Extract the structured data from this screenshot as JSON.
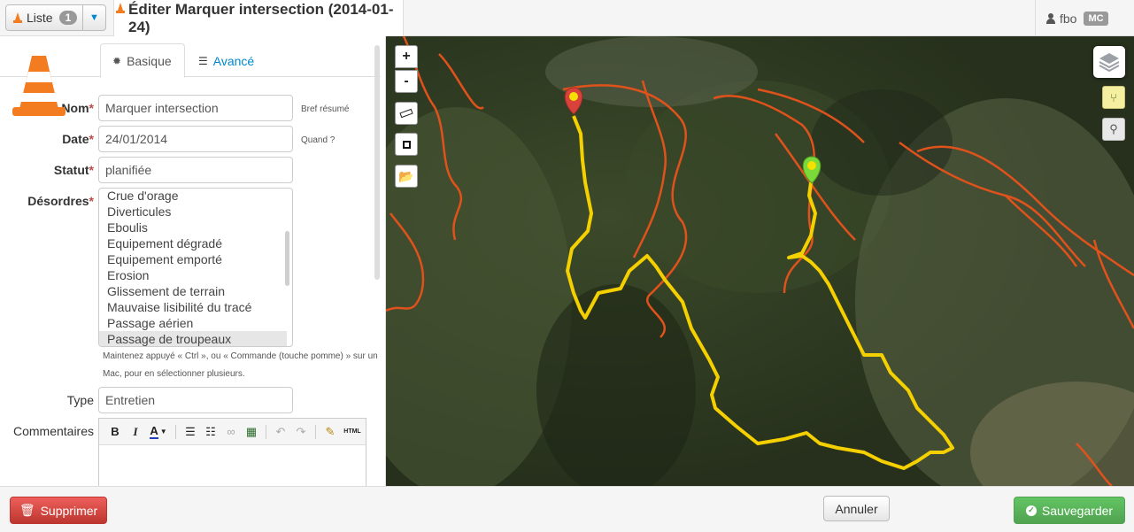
{
  "topbar": {
    "list_label": "Liste",
    "list_count": "1",
    "title": "Éditer Marquer intersection (2014-01-24)",
    "username": "fbo",
    "user_initials": "MC"
  },
  "tabs": [
    {
      "label": "Basique",
      "icon": "gear-icon",
      "active": true
    },
    {
      "label": "Avancé",
      "icon": "list-icon",
      "active": false
    }
  ],
  "form": {
    "nom": {
      "label": "Nom",
      "value": "Marquer intersection",
      "hint": "Bref résumé"
    },
    "date": {
      "label": "Date",
      "value": "24/01/2014",
      "hint": "Quand ?"
    },
    "statut": {
      "label": "Statut",
      "value": "planifiée"
    },
    "desordres": {
      "label": "Désordres",
      "options": [
        "Crue d'orage",
        "Diverticules",
        "Eboulis",
        "Equipement dégradé",
        "Equipement emporté",
        "Erosion",
        "Glissement de terrain",
        "Mauvaise lisibilité du tracé",
        "Passage aérien",
        "Passage de troupeaux"
      ],
      "selected": "Passage de troupeaux",
      "help_line1": "Maintenez appuyé « Ctrl », ou « Commande (touche pomme) » sur un",
      "help_line2": "Mac, pour en sélectionner plusieurs."
    },
    "type": {
      "label": "Type",
      "value": "Entretien"
    },
    "commentaires": {
      "label": "Commentaires",
      "toolbar_html_label": "HTML"
    }
  },
  "map_controls": {
    "zoom_in": "+",
    "zoom_out": "-"
  },
  "footer": {
    "delete_label": "Supprimer",
    "cancel_label": "Annuler",
    "save_label": "Sauvegarder"
  },
  "colors": {
    "accent": "#0088cc",
    "danger": "#bd362f",
    "success": "#51a351",
    "track": "#f5d000",
    "trail": "#e0521c",
    "marker_start": "#d9413b",
    "marker_end": "#7bd93a"
  }
}
